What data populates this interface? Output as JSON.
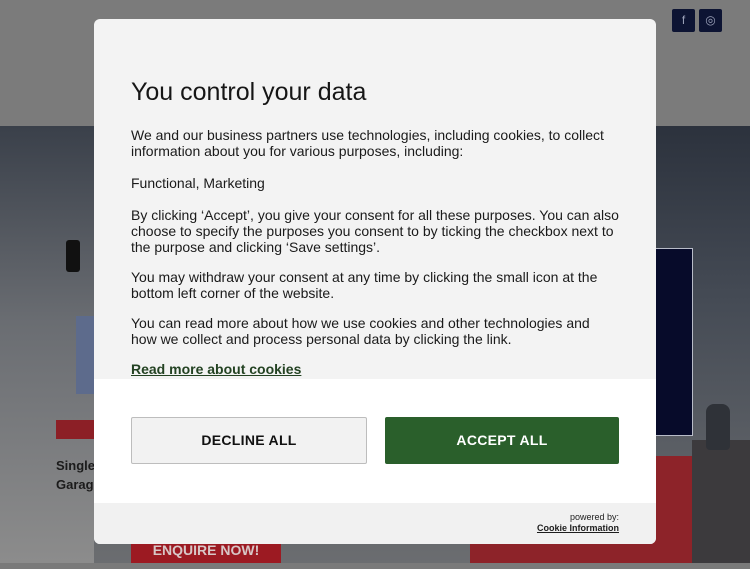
{
  "background": {
    "social_icons": [
      {
        "icon": "facebook-icon",
        "glyph": "f"
      },
      {
        "icon": "instagram-icon",
        "glyph": "◎"
      }
    ],
    "product_text_line1": "Single",
    "product_text_line2": "Garag",
    "enquire_label": "ENQUIRE NOW!"
  },
  "consent": {
    "title": "You control your data",
    "paragraph1": "We and our business partners use technologies, including cookies, to collect information about you for various purposes, including:",
    "purposes": "Functional, Marketing",
    "paragraph3": "By clicking ‘Accept’, you give your consent for all these purposes. You can also choose to specify the purposes you consent to by ticking the checkbox next to the purpose and clicking ‘Save settings’.",
    "paragraph4": "You may withdraw your consent at any time by clicking the small icon at the bottom left corner of the website.",
    "paragraph5": "You can read more about how we use cookies and other technologies and how we collect and process personal data by clicking the link.",
    "read_more_link": "Read more about cookies",
    "decline_label": "DECLINE ALL",
    "accept_label": "ACCEPT ALL",
    "powered_by": "powered by:",
    "provider_link": "Cookie Information"
  },
  "colors": {
    "accept_button": "#2a5f2b",
    "link_green": "#234222",
    "enquire_red": "#9c1a22",
    "navy": "#0d1433"
  }
}
